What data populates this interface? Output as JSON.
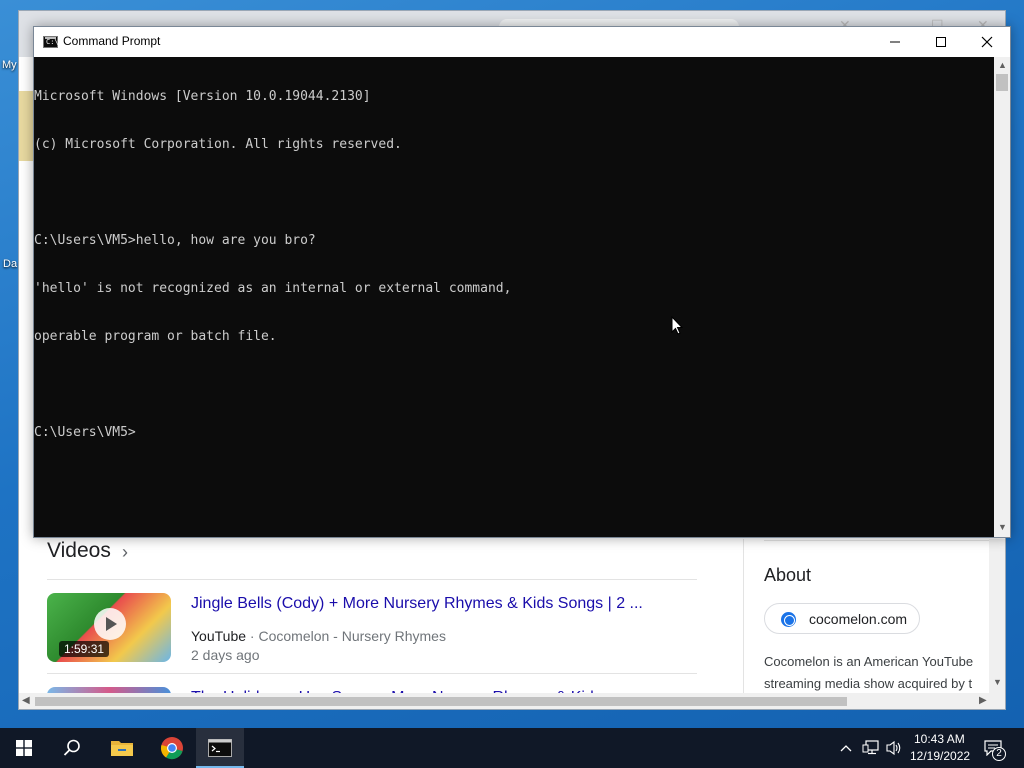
{
  "desktop": {
    "icon_labels": [
      "My",
      "Da"
    ]
  },
  "browser": {
    "videos_heading": "Videos",
    "videos": [
      {
        "title": "Jingle Bells (Cody) + More Nursery Rhymes & Kids Songs | 2 ...",
        "source": "YouTube",
        "channel": "Cocomelon - Nursery Rhymes",
        "date": "2 days ago",
        "duration": "1:59:31"
      },
      {
        "title": "The Holiday ... Hey Song ... More Nursery Rhymes & Kids ..."
      }
    ],
    "about": {
      "heading": "About",
      "site": "cocomelon.com",
      "lines": [
        "Cocomelon is an American YouTube",
        "streaming media show acquired by t"
      ]
    }
  },
  "cmd": {
    "title": "Command Prompt",
    "icon_text": "C:\\_",
    "console_lines": [
      "Microsoft Windows [Version 10.0.19044.2130]",
      "(c) Microsoft Corporation. All rights reserved.",
      "",
      "C:\\Users\\VM5>hello, how are you bro?",
      "'hello' is not recognized as an internal or external command,",
      "operable program or batch file.",
      "",
      "C:\\Users\\VM5>"
    ]
  },
  "taskbar": {
    "pinned": [
      "start",
      "search",
      "file-explorer",
      "chrome",
      "command-prompt"
    ],
    "time": "10:43 AM",
    "date": "12/19/2022",
    "notification_count": "2"
  }
}
